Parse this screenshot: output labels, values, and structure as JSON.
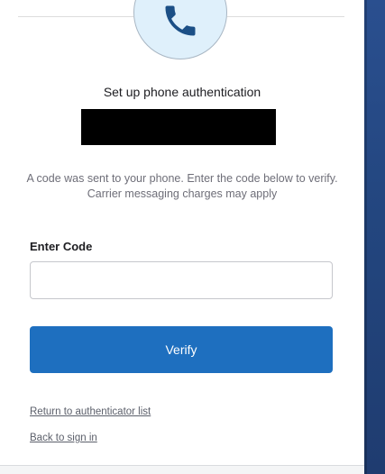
{
  "icon": {
    "name": "phone-icon",
    "circle_color": "#dff0fb",
    "glyph_color": "#1b4f86"
  },
  "title": "Set up phone authentication",
  "redacted": {
    "color": "#000000"
  },
  "info": {
    "line1": "A code was sent to your phone. Enter the code below to verify.",
    "line2": "Carrier messaging charges may apply"
  },
  "code_field": {
    "label": "Enter Code",
    "value": "",
    "placeholder": ""
  },
  "verify_button": {
    "label": "Verify",
    "color": "#1e6fbf"
  },
  "links": {
    "return_label": "Return to authenticator list",
    "back_label": "Back to sign in"
  },
  "side_panel": {
    "color": "#23467f"
  }
}
